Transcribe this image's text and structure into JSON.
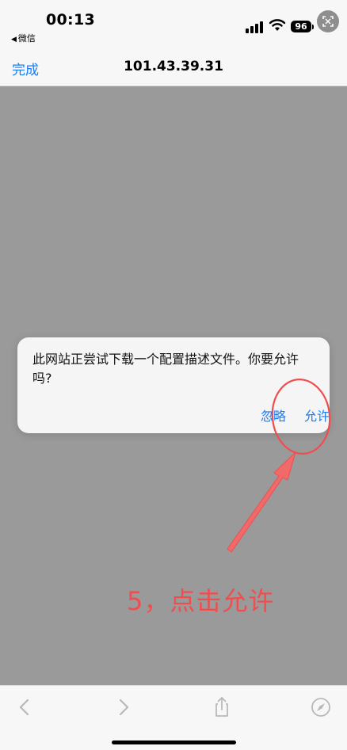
{
  "status_bar": {
    "time": "00:13",
    "back_app": "微信",
    "back_arrow_glyph": "◀",
    "battery": "96"
  },
  "nav": {
    "done_label": "完成",
    "title": "101.43.39.31"
  },
  "alert": {
    "message": "此网站正尝试下载一个配置描述文件。你要允许吗?",
    "ignore_label": "忽略",
    "allow_label": "允许"
  },
  "annotation": {
    "text": "5，点击允许"
  },
  "colors": {
    "accent": "#1a7cf4",
    "overlay": "#9a9a9a",
    "annotation": "#f04e4e"
  },
  "icons": [
    "back-chevron-icon",
    "forward-chevron-icon",
    "share-icon",
    "compass-icon"
  ]
}
